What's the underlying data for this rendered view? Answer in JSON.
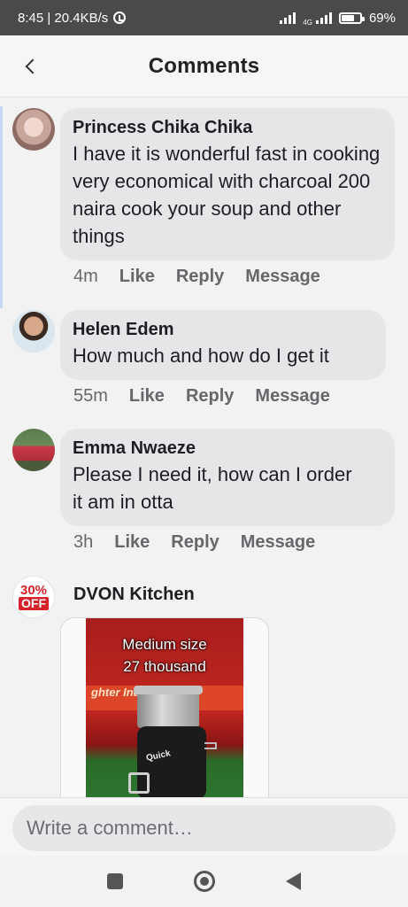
{
  "status_bar": {
    "time_speed": "8:45 | 20.4KB/s",
    "network": "4G",
    "battery": "69%",
    "battery_level": 0.69
  },
  "header": {
    "title": "Comments"
  },
  "comments": [
    {
      "author": "Princess Chika Chika",
      "text": "I have it is wonderful  fast in cooking very economical with charcoal 200 naira cook your soup and other things",
      "time": "4m",
      "like": "Like",
      "reply": "Reply",
      "message": "Message"
    },
    {
      "author": "Helen Edem",
      "text": "How much and how do I get it",
      "time": "55m",
      "like": "Like",
      "reply": "Reply",
      "message": "Message"
    },
    {
      "author": "Emma Nwaeze",
      "text": "Please I need it, how can I order it am in otta",
      "time": "3h",
      "like": "Like",
      "reply": "Reply",
      "message": "Message"
    }
  ],
  "shop_comment": {
    "author": "DVON Kitchen",
    "avatar_badge_top": "30%",
    "avatar_badge_bottom": "OFF",
    "image_caption_line1": "Medium size",
    "image_caption_line2": "27 thousand",
    "image_banner_text": "ghter Industrie",
    "image_stove_logo": "Quick"
  },
  "composer": {
    "placeholder": "Write a comment…"
  },
  "colors": {
    "bubble": "#e6e6e9",
    "action_gray": "#65676b",
    "status_bar": "#4a4a4a"
  }
}
